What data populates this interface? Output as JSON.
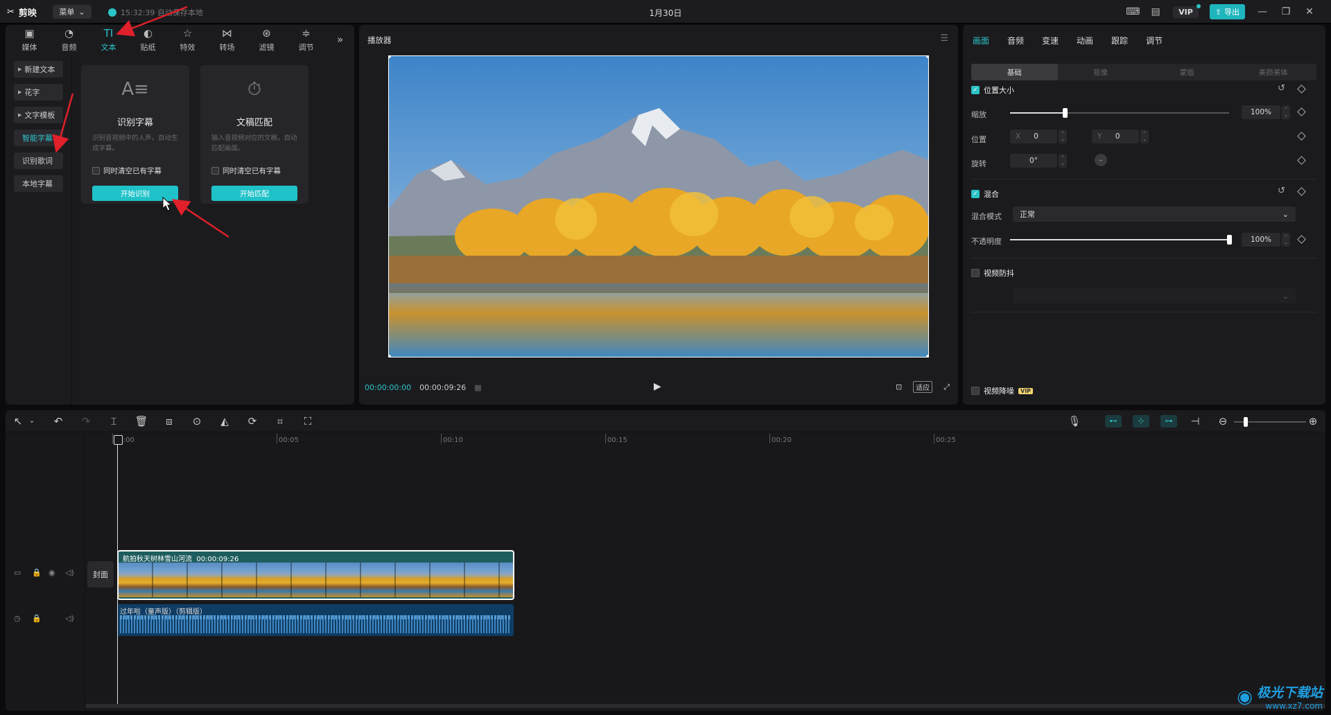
{
  "titlebar": {
    "logo": "剪映",
    "menu": "菜单",
    "save_status": "15:32:39 自动保存本地",
    "date": "1月30日",
    "vip": "VIP",
    "export": "导出"
  },
  "left_tabs": [
    {
      "label": "媒体",
      "icon": "media-icon",
      "glyph": "▣"
    },
    {
      "label": "音频",
      "icon": "audio-icon",
      "glyph": "◔"
    },
    {
      "label": "文本",
      "icon": "text-icon",
      "glyph": "TI",
      "active": true
    },
    {
      "label": "贴纸",
      "icon": "sticker-icon",
      "glyph": "◐"
    },
    {
      "label": "特效",
      "icon": "effects-icon",
      "glyph": "☆"
    },
    {
      "label": "转场",
      "icon": "transition-icon",
      "glyph": "⋈"
    },
    {
      "label": "滤镜",
      "icon": "filter-icon",
      "glyph": "⊛"
    },
    {
      "label": "调节",
      "icon": "adjust-icon",
      "glyph": "≑"
    }
  ],
  "categories": [
    {
      "label": "新建文本",
      "arrow": true
    },
    {
      "label": "花字",
      "arrow": true
    },
    {
      "label": "文字模板",
      "arrow": true
    },
    {
      "label": "智能字幕",
      "active": true
    },
    {
      "label": "识别歌词"
    },
    {
      "label": "本地字幕"
    }
  ],
  "cards": [
    {
      "title": "识别字幕",
      "desc": "识别音视频中的人声，自动生成字幕。",
      "checkbox": "同时清空已有字幕",
      "button": "开始识别",
      "icon_glyph": "A≡"
    },
    {
      "title": "文稿匹配",
      "desc": "输入音视频对应的文稿，自动匹配画面。",
      "checkbox": "同时清空已有字幕",
      "button": "开始匹配",
      "icon_glyph": "⏱"
    }
  ],
  "player": {
    "title": "播放器",
    "current_time": "00:00:00:00",
    "total_time": "00:00:09:26",
    "fit_label": "适应"
  },
  "props": {
    "tabs": [
      "画面",
      "音频",
      "变速",
      "动画",
      "跟踪",
      "调节"
    ],
    "subtabs": [
      "基础",
      "抠像",
      "蒙版",
      "美颜美体"
    ],
    "pos_size": {
      "title": "位置大小",
      "scale_label": "缩放",
      "scale_value": "100%",
      "scale_fraction": 0.25,
      "position_label": "位置",
      "x_label": "X",
      "x_value": "0",
      "y_label": "Y",
      "y_value": "0",
      "rotate_label": "旋转",
      "rotate_value": "0°"
    },
    "blend": {
      "title": "混合",
      "mode_label": "混合模式",
      "mode_value": "正常",
      "opacity_label": "不透明度",
      "opacity_value": "100%",
      "opacity_fraction": 1.0
    },
    "stabilize": {
      "title": "视频防抖"
    },
    "denoise": {
      "title": "视频降噪",
      "badge": "VIP"
    }
  },
  "timeline": {
    "ruler": [
      "00:00",
      "00:05",
      "00:10",
      "00:15",
      "00:20",
      "00:25"
    ],
    "cover_label": "封面",
    "video_clip": {
      "name": "航拍秋天树林雪山河流",
      "duration": "00:00:09:26"
    },
    "audio_clip": {
      "name": "过年啦（童声版）（剪辑版）"
    }
  },
  "watermark": {
    "title": "极光下载站",
    "url": "www.xz7.com"
  }
}
